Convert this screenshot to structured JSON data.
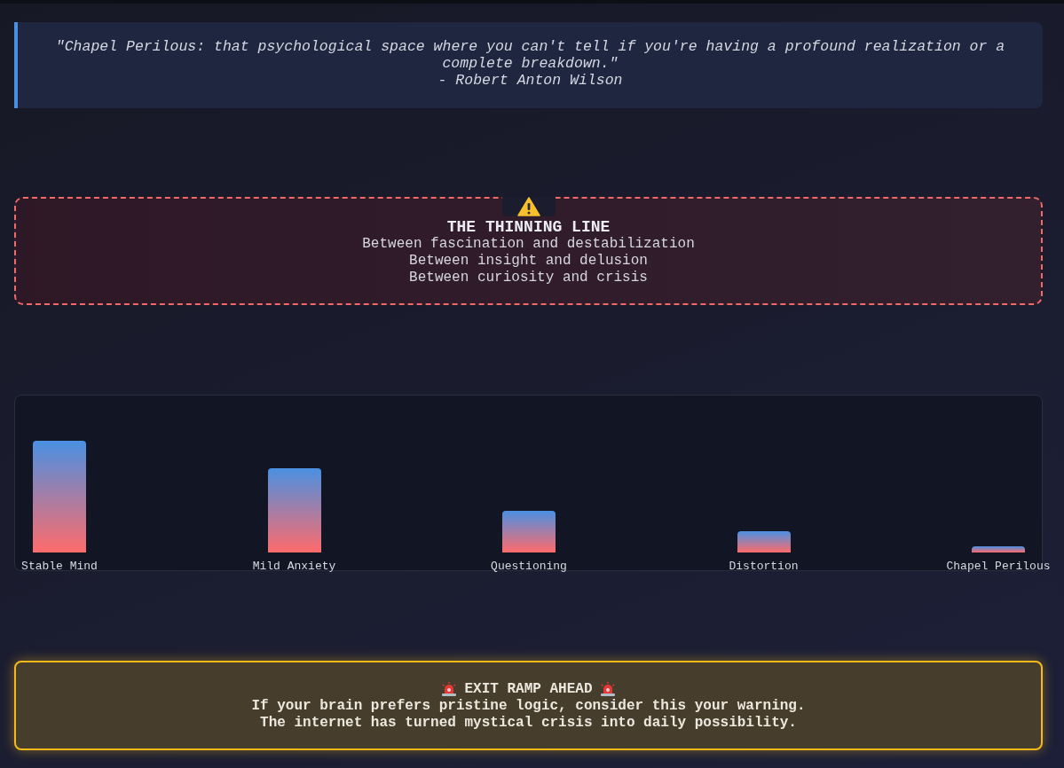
{
  "quote": {
    "text": "\"Chapel Perilous: that psychological space where you can't tell if you're having a profound realization or a complete breakdown.\"",
    "attribution": "- Robert Anton Wilson"
  },
  "warning": {
    "title": "THE THINNING LINE",
    "lines": [
      "Between fascination and destabilization",
      "Between insight and delusion",
      "Between curiosity and crisis"
    ]
  },
  "stages": [
    {
      "label": "Stable Mind"
    },
    {
      "label": "Mild Anxiety"
    },
    {
      "label": "Questioning"
    },
    {
      "label": "Distortion"
    },
    {
      "label": "Chapel Perilous"
    }
  ],
  "exit_notice": {
    "title": "EXIT RAMP AHEAD",
    "lines": [
      "If your brain prefers pristine logic, consider this your warning.",
      "The internet has turned mystical crisis into daily possibility."
    ]
  }
}
